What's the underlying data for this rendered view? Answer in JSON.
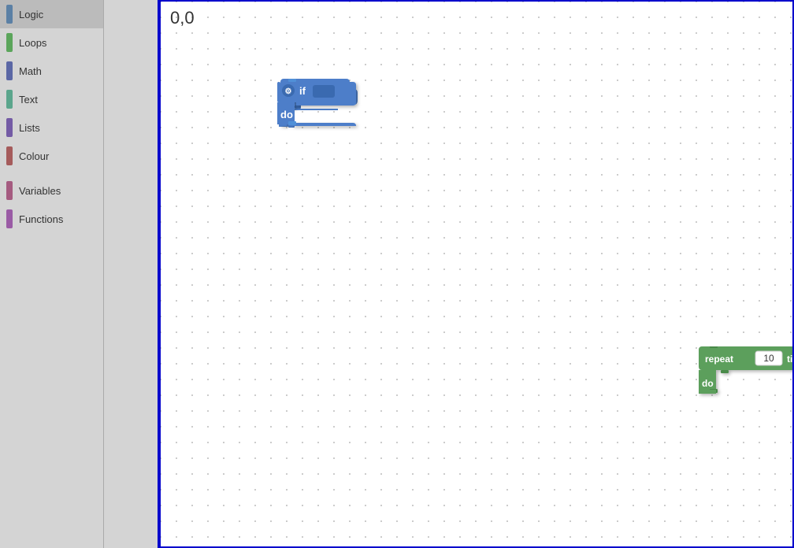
{
  "sidebar": {
    "categories": [
      {
        "id": "logic",
        "label": "Logic",
        "color": "#5b80a5"
      },
      {
        "id": "loops",
        "label": "Loops",
        "color": "#5ba55b"
      },
      {
        "id": "math",
        "label": "Math",
        "color": "#5b67a5"
      },
      {
        "id": "text",
        "label": "Text",
        "color": "#5ba58c"
      },
      {
        "id": "lists",
        "label": "Lists",
        "color": "#745ba5"
      },
      {
        "id": "colour",
        "label": "Colour",
        "color": "#a55b5b"
      },
      {
        "id": "variables",
        "label": "Variables",
        "color": "#a55b80"
      },
      {
        "id": "functions",
        "label": "Functions",
        "color": "#9a5ba5"
      }
    ]
  },
  "workspace": {
    "coordinates": "0,0"
  },
  "blocks": {
    "if_block": {
      "label_if": "if",
      "label_do": "do"
    },
    "repeat_block": {
      "label_repeat": "repeat",
      "label_times": "times",
      "label_do": "do",
      "value": "10"
    }
  }
}
